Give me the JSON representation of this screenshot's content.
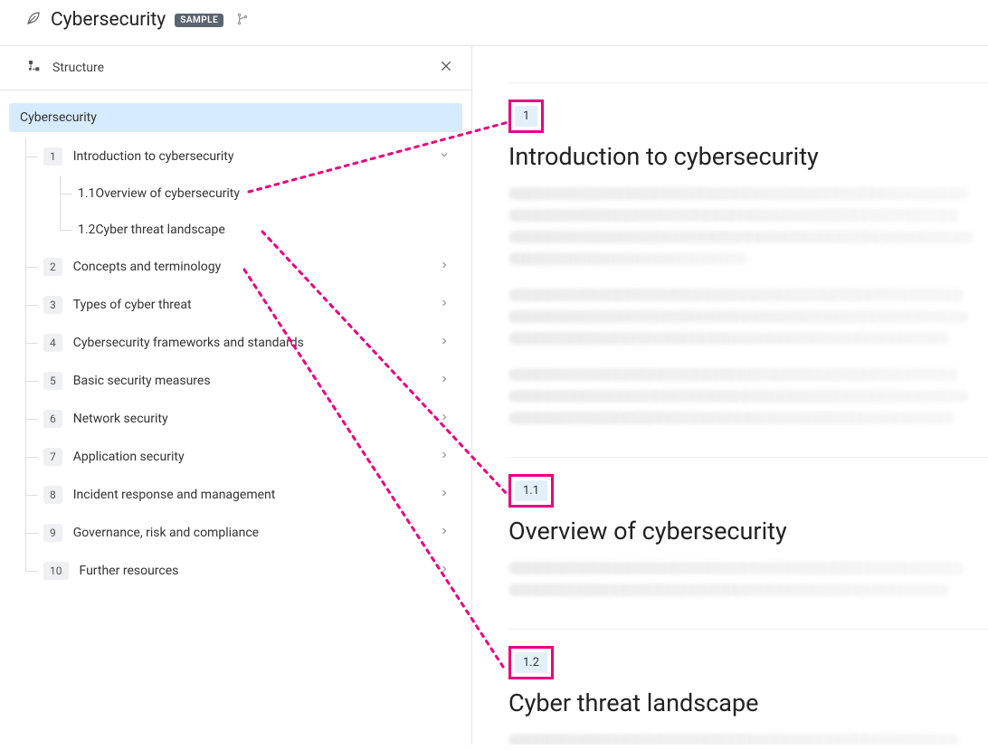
{
  "header": {
    "title": "Cybersecurity",
    "badge": "SAMPLE"
  },
  "sidebar": {
    "title": "Structure",
    "root": "Cybersecurity",
    "items": [
      {
        "num": "1",
        "label": "Introduction to cybersecurity",
        "expanded": true,
        "children": [
          {
            "num": "1.1",
            "label": "Overview of cybersecurity"
          },
          {
            "num": "1.2",
            "label": "Cyber threat landscape"
          }
        ]
      },
      {
        "num": "2",
        "label": "Concepts and terminology"
      },
      {
        "num": "3",
        "label": "Types of cyber threat"
      },
      {
        "num": "4",
        "label": "Cybersecurity frameworks and standards"
      },
      {
        "num": "5",
        "label": "Basic security measures"
      },
      {
        "num": "6",
        "label": "Network security"
      },
      {
        "num": "7",
        "label": "Application security"
      },
      {
        "num": "8",
        "label": "Incident response and management"
      },
      {
        "num": "9",
        "label": "Governance, risk and compliance"
      },
      {
        "num": "10",
        "label": "Further resources"
      }
    ]
  },
  "content": {
    "sections": [
      {
        "num": "1",
        "title": "Introduction to cybersecurity"
      },
      {
        "num": "1.1",
        "title": "Overview of cybersecurity"
      },
      {
        "num": "1.2",
        "title": "Cyber threat landscape"
      }
    ]
  },
  "colors": {
    "highlight": "#e6007e",
    "numbox_bg": "#e3f0fc",
    "selected_bg": "#d6ebff"
  }
}
